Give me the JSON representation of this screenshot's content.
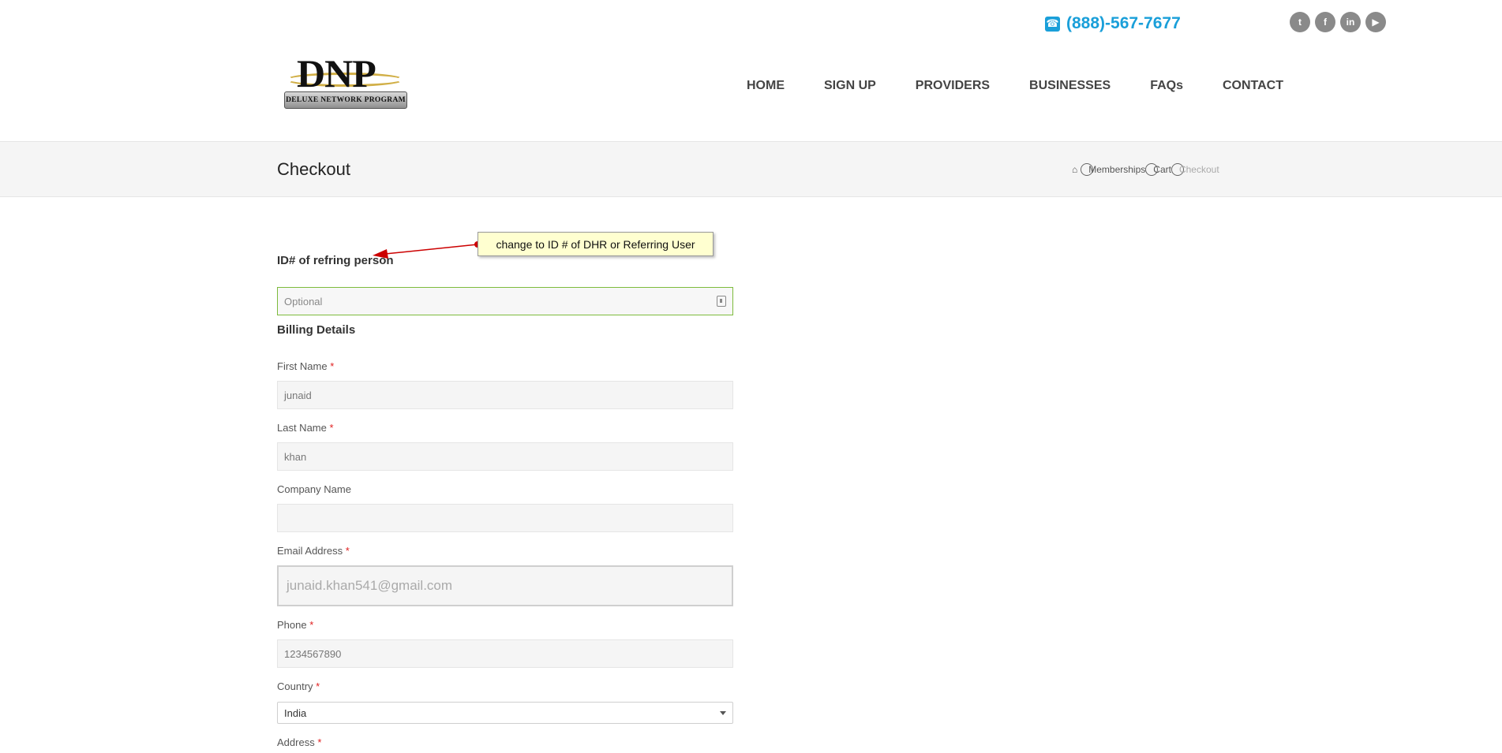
{
  "header": {
    "phone": "(888)-567-7677",
    "socials": [
      "twitter-icon",
      "facebook-icon",
      "linkedin-icon",
      "youtube-icon"
    ],
    "logo": {
      "title": "DNP",
      "subtitle": "DELUXE NETWORK PROGRAM"
    },
    "nav": [
      "HOME",
      "SIGN UP",
      "PROVIDERS",
      "BUSINESSES",
      "FAQs",
      "CONTACT"
    ]
  },
  "title_band": {
    "title": "Checkout",
    "breadcrumb": [
      "Memberships",
      "Cart",
      "Checkout"
    ]
  },
  "form": {
    "referral": {
      "label": "ID# of refring person",
      "placeholder": "Optional"
    },
    "billing_title": "Billing Details",
    "required_mark": "*",
    "fields": {
      "first_name": {
        "label": "First Name",
        "value": "junaid"
      },
      "last_name": {
        "label": "Last Name",
        "value": "khan"
      },
      "company": {
        "label": "Company Name",
        "value": ""
      },
      "email": {
        "label": "Email Address",
        "value": "junaid.khan541@gmail.com"
      },
      "phone": {
        "label": "Phone",
        "value": "1234567890"
      },
      "country": {
        "label": "Country",
        "value": "India"
      },
      "address": {
        "label": "Address"
      }
    }
  },
  "annotation": {
    "text": "change to ID # of DHR or Referring User",
    "color": "#cc0000"
  },
  "colors": {
    "accent": "#1a9fd9",
    "valid_border": "#7dbb3c",
    "required": "#e02020"
  }
}
